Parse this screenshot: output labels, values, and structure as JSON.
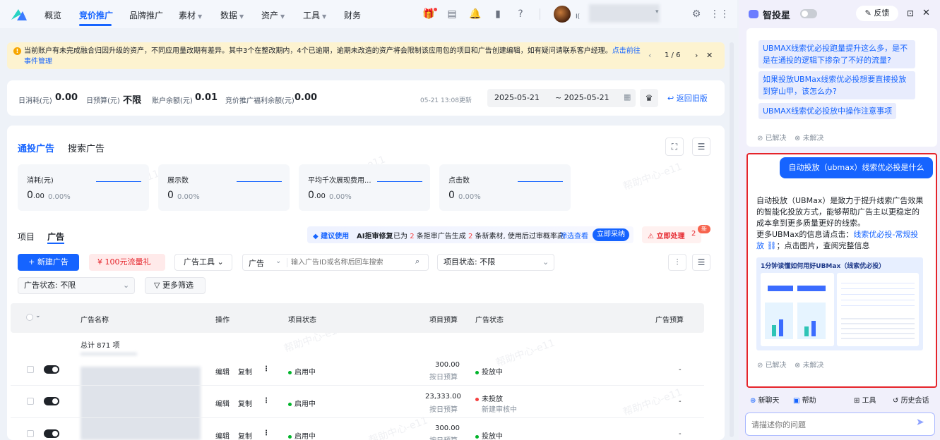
{
  "nav": {
    "items": [
      "概览",
      "竞价推广",
      "品牌推广",
      "素材",
      "数据",
      "资产",
      "工具",
      "财务"
    ],
    "active": "竞价推广",
    "user_initial": "I("
  },
  "notice": {
    "text": "当前账户有未完成融合归因升级的资产，不同应用量改期有差异。其中3个在整改期内，4个已逾期，逾期未改造的资产将会限制该应用包的项目和广告创建编辑，如有疑问请联系客户经理。",
    "link": "点击前往事件管理",
    "pager": "1 / 6"
  },
  "stats": {
    "daily_spend_label": "日消耗(元)",
    "daily_spend": "0.00",
    "daily_budget_label": "日预算(元)",
    "daily_budget": "不限",
    "balance_label": "账户余额(元)",
    "balance": "0.01",
    "welfare_label": "竞价推广福利余额(元)",
    "welfare": "0.00",
    "updated": "05-21 13:08更新",
    "date_start": "2025-05-21",
    "date_end": "~ 2025-05-21",
    "back_label": "返回旧版"
  },
  "main": {
    "tabs": [
      "通投广告",
      "搜索广告"
    ],
    "metrics": [
      {
        "label": "消耗(元)",
        "value": "0",
        "decimal": ".00",
        "pct": "0.00%"
      },
      {
        "label": "展示数",
        "value": "0",
        "decimal": "",
        "pct": "0.00%"
      },
      {
        "label": "平均千次展现费用...",
        "value": "0",
        "decimal": ".00",
        "pct": "0.00%"
      },
      {
        "label": "点击数",
        "value": "0",
        "decimal": "",
        "pct": "0.00%"
      }
    ],
    "subtabs": [
      "项目",
      "广告"
    ],
    "promo": {
      "suggest": "建议使用",
      "title": "AI拒审修复",
      "text_a": "已为",
      "num_a": "2",
      "text_b": "条拒审广告生成",
      "num_b": "2",
      "text_c": "条新素材, 使用后过审概率高",
      "link": "筛选查看",
      "button": "立即采纳",
      "urgent": "立即处理",
      "urgent_count": "2",
      "new_badge": "新"
    },
    "toolbar": {
      "new_ad": "+ 新建广告",
      "gift": "100元流量礼",
      "ad_tools": "广告工具",
      "search_type": "广告",
      "search_placeholder": "输入广告ID或名称后回车搜索",
      "project_status_label": "项目状态:",
      "project_status": "不限",
      "ad_status_label": "广告状态:",
      "ad_status": "不限",
      "more_filter": "更多筛选"
    },
    "table": {
      "headers": [
        "广告名称",
        "操作",
        "项目状态",
        "项目预算",
        "广告状态",
        "广告预算"
      ],
      "total": "总计 871 项",
      "rows": [
        {
          "edit": "编辑",
          "copy": "复制",
          "project_status": "启用中",
          "budget": "300.00",
          "budget_type": "按日预算",
          "ad_status": "投放中",
          "ad_status2": "",
          "ad_budget": "-",
          "ad_color": "green"
        },
        {
          "edit": "编辑",
          "copy": "复制",
          "project_status": "启用中",
          "budget": "23,333.00",
          "budget_type": "按日预算",
          "ad_status": "未投放",
          "ad_status2": "新建审核中",
          "ad_budget": "-",
          "ad_color": "red"
        },
        {
          "edit": "编辑",
          "copy": "复制",
          "project_status": "启用中",
          "budget": "300.00",
          "budget_type": "按日预算",
          "ad_status": "投放中",
          "ad_status2": "",
          "ad_budget": "-",
          "ad_color": "green"
        }
      ]
    },
    "watermark": "帮助中心-e11"
  },
  "panel": {
    "title": "智投星",
    "feedback": "反馈",
    "questions": [
      "UBMAX线索优必投跑量提升这么多，是不是在通投的逻辑下掺杂了不好的流量?",
      "如果投放UBMax线索优必投想要直接投放到穿山甲，该怎么办?",
      "UBMAX线索优必投放中操作注意事项"
    ],
    "resolved": "已解决",
    "unresolved": "未解决",
    "user_question": "自动投放（ubmax）线索优必投是什么",
    "answer_p1": "自动投放（UBMax）是致力于提升线索广告效果的智能化投放方式，能够帮助广告主以更稳定的成本拿到更多质量更好的线索。",
    "answer_p2a": "更多UBMax的信息请点击：",
    "answer_link": "线索优必投-常规投放",
    "answer_p2b": "；点击图片，查阅完整信息",
    "infographic_title": "1分钟读懂如何用好UBMax（线索优必投）",
    "footer": [
      "新聊天",
      "帮助",
      "工具",
      "历史会话"
    ],
    "input_placeholder": "请描述你的问题"
  }
}
